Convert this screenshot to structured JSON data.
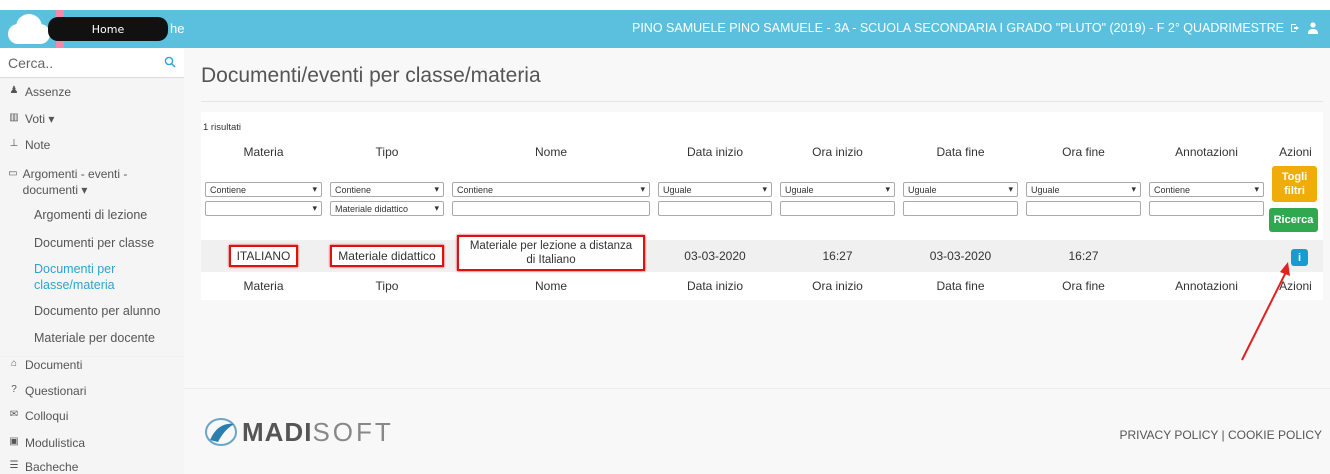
{
  "topbar": {
    "bacheche_partial": "he",
    "home_tooltip": "Home",
    "user_info": "PINO SAMUELE  PINO SAMUELE - 3A - SCUOLA SECONDARIA I GRADO \"PLUTO\" (2019) - F  2° QUADRIMESTRE",
    "logout_icon": "sign-out-icon",
    "user_icon": "user-icon"
  },
  "sidebar": {
    "search_placeholder": "Cerca..",
    "items": [
      {
        "icon": "user-icon",
        "glyph": "♟",
        "label": "Assenze"
      },
      {
        "icon": "bank-icon",
        "glyph": "▥",
        "label": "Voti ▾"
      },
      {
        "icon": "pin-icon",
        "glyph": "⊥",
        "label": "Note"
      },
      {
        "icon": "folder-open-icon",
        "glyph": "▭",
        "label": "Argomenti - eventi - documenti ▾"
      }
    ],
    "subitems": [
      {
        "label": "Argomenti di lezione",
        "active": false
      },
      {
        "label": "Documenti per classe",
        "active": false
      },
      {
        "label": "Documenti per classe/materia",
        "active": true
      },
      {
        "label": "Documento per alunno",
        "active": false
      },
      {
        "label": "Materiale per docente",
        "active": false
      }
    ],
    "items_bottom": [
      {
        "icon": "graduation-cap-icon",
        "glyph": "⌂",
        "label": "Documenti"
      },
      {
        "icon": "question-icon",
        "glyph": "?",
        "label": "Questionari"
      },
      {
        "icon": "comments-icon",
        "glyph": "✉",
        "label": "Colloqui"
      },
      {
        "icon": "briefcase-icon",
        "glyph": "▣",
        "label": "Modulistica"
      },
      {
        "icon": "list-icon",
        "glyph": "☰",
        "label": "Bacheche"
      }
    ]
  },
  "main": {
    "title": "Documenti/eventi per classe/materia",
    "results": "1 risultati",
    "columns": [
      "Materia",
      "Tipo",
      "Nome",
      "Data inizio",
      "Ora inizio",
      "Data fine",
      "Ora fine",
      "Annotazioni",
      "Azioni"
    ],
    "filters": [
      "Contiene",
      "Contiene",
      "Contiene",
      "Uguale",
      "Uguale",
      "Uguale",
      "Uguale",
      "Contiene"
    ],
    "tipo_value": "Materiale didattico",
    "row": {
      "materia": "ITALIANO",
      "tipo": "Materiale didattico",
      "nome": "Materiale per lezione a distanza di Italiano",
      "data_inizio": "03-03-2020",
      "ora_inizio": "16:27",
      "data_fine": "03-03-2020",
      "ora_fine": "16:27",
      "annotazioni": ""
    },
    "btn_togli": "Togli filtri",
    "btn_ricerca": "Ricerca",
    "btn_info": "i"
  },
  "footer": {
    "logo_bold": "MADI",
    "logo_light": "SOFT",
    "privacy": "PRIVACY POLICY",
    "sep": "|",
    "cookie": "COOKIE POLICY"
  },
  "colors": {
    "topbar": "#5bc0de",
    "active_link": "#2aa4d4",
    "highlight": "#dd1111",
    "btn_warning": "#f0ad0a",
    "btn_success": "#2fa84f",
    "btn_info": "#1a9bd0"
  }
}
